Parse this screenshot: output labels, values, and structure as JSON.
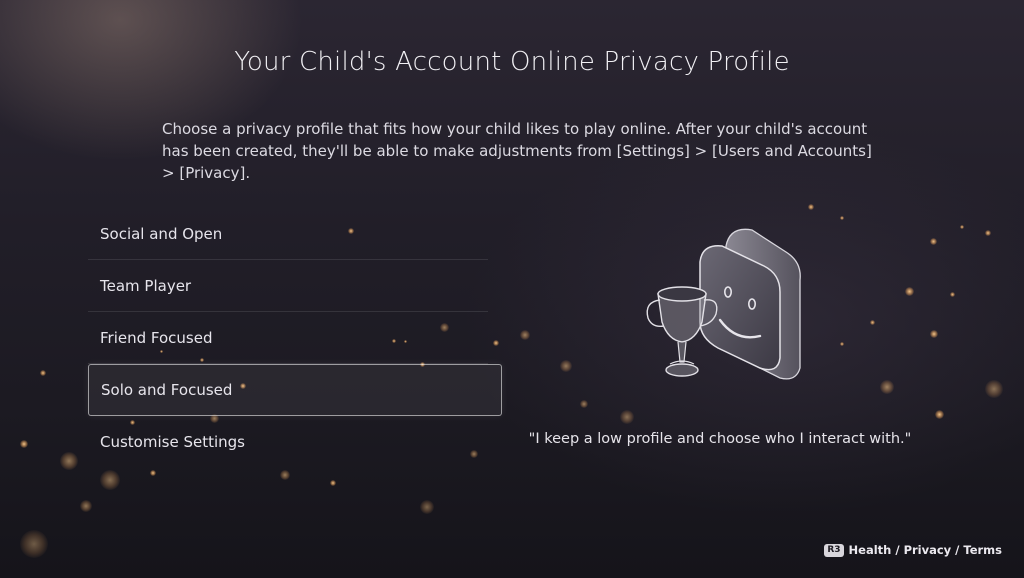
{
  "page": {
    "title": "Your Child's Account Online Privacy Profile",
    "description": "Choose a privacy profile that fits how your child likes to play online. After your child's account has been created, they'll be able to make adjustments from [Settings] > [Users and Accounts] > [Privacy]."
  },
  "options": [
    {
      "label": "Social and Open",
      "selected": false
    },
    {
      "label": "Team Player",
      "selected": false
    },
    {
      "label": "Friend Focused",
      "selected": false
    },
    {
      "label": "Solo and Focused",
      "selected": true
    },
    {
      "label": "Customise Settings",
      "selected": false
    }
  ],
  "illustration": {
    "icon": "trophy-and-smiley-face-icon"
  },
  "quote": "\"I keep a low profile and choose who I interact with.\"",
  "footer": {
    "button": "R3",
    "links": "Health / Privacy / Terms"
  },
  "colors": {
    "background": "#211e28",
    "text": "#e9e7ee",
    "sparkle": "#e8b070"
  }
}
